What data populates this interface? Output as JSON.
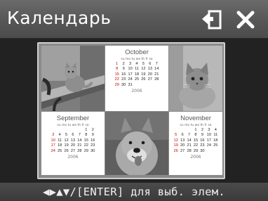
{
  "header": {
    "title": "Календарь",
    "return_icon": "return-icon",
    "close_icon": "close-icon"
  },
  "calendars": {
    "october": {
      "month": "October",
      "days": "su mo tu we th fr sa",
      "rows": [
        [
          "",
          "",
          "",
          "",
          "",
          "",
          ""
        ],
        [
          "1",
          "2",
          "3",
          "4",
          "5",
          "6",
          "7"
        ],
        [
          "8",
          "9",
          "10",
          "11",
          "12",
          "13",
          "14"
        ],
        [
          "15",
          "16",
          "17",
          "18",
          "19",
          "20",
          "21"
        ],
        [
          "22",
          "23",
          "24",
          "25",
          "26",
          "27",
          "28"
        ],
        [
          "29",
          "30",
          "31",
          "",
          "",
          "",
          ""
        ]
      ],
      "year": "2006"
    },
    "september": {
      "month": "September",
      "days": "su mo tu we th fr sa",
      "rows": [
        [
          "",
          "",
          "",
          "",
          "",
          "1",
          "2"
        ],
        [
          "3",
          "4",
          "5",
          "6",
          "7",
          "8",
          "9"
        ],
        [
          "10",
          "11",
          "12",
          "13",
          "14",
          "15",
          "16"
        ],
        [
          "17",
          "18",
          "19",
          "20",
          "21",
          "22",
          "23"
        ],
        [
          "24",
          "25",
          "26",
          "27",
          "28",
          "29",
          "30"
        ]
      ],
      "year": "2006"
    },
    "november": {
      "month": "November",
      "days": "su mo tu we th fr sa",
      "rows": [
        [
          "",
          "",
          "",
          "1",
          "2",
          "3",
          "4"
        ],
        [
          "5",
          "6",
          "7",
          "8",
          "9",
          "10",
          "11"
        ],
        [
          "12",
          "13",
          "14",
          "15",
          "16",
          "17",
          "18"
        ],
        [
          "19",
          "20",
          "21",
          "22",
          "23",
          "24",
          "25"
        ],
        [
          "26",
          "27",
          "28",
          "29",
          "30",
          "",
          ""
        ]
      ],
      "year": "2006"
    }
  },
  "footer": {
    "hint": "◀▶▲▼/[ENTER] для выб. элем."
  },
  "colors": {
    "titlebar": "#5e5e5e",
    "background": "#2b2b2b",
    "sunday": "#c00000"
  }
}
